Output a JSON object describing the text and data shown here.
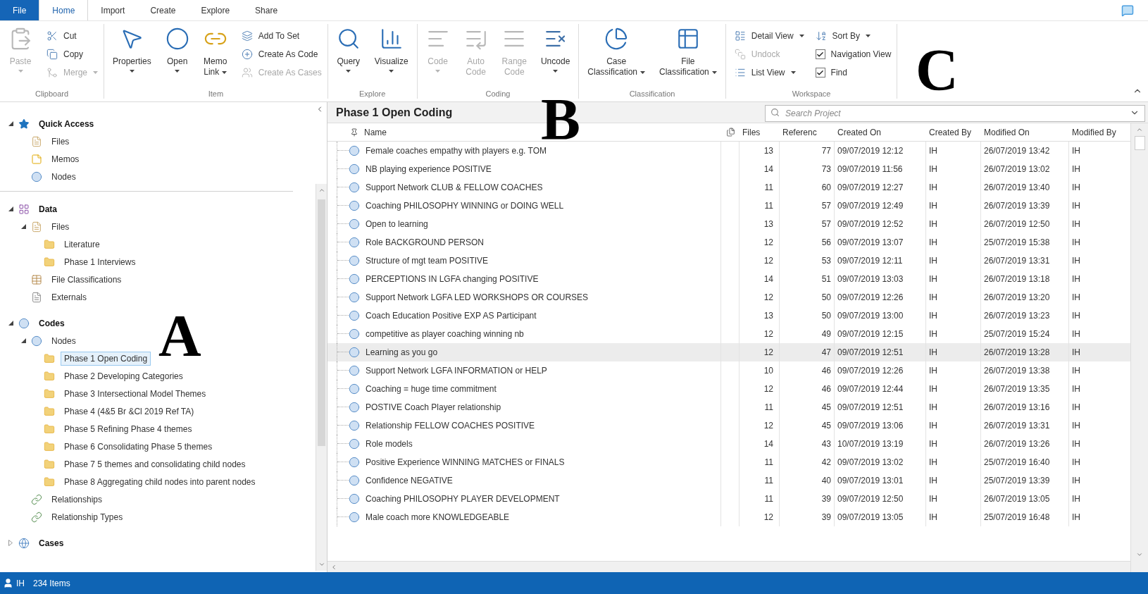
{
  "tabs": [
    {
      "label": "File",
      "kind": "file",
      "selected": false
    },
    {
      "label": "Home",
      "kind": "tab",
      "selected": true
    },
    {
      "label": "Import",
      "kind": "tab",
      "selected": false
    },
    {
      "label": "Create",
      "kind": "tab",
      "selected": false
    },
    {
      "label": "Explore",
      "kind": "tab",
      "selected": false
    },
    {
      "label": "Share",
      "kind": "tab",
      "selected": false
    }
  ],
  "ribbon": {
    "groups": [
      {
        "label": "Clipboard",
        "large": [
          {
            "lines": [
              "Paste"
            ],
            "dropdown": true,
            "disabled": true
          }
        ],
        "small_columns": [
          [
            {
              "kind": "button",
              "label": "Cut",
              "dropdown": false,
              "disabled": false
            },
            {
              "kind": "button",
              "label": "Copy",
              "dropdown": false,
              "disabled": false
            },
            {
              "kind": "button",
              "label": "Merge",
              "dropdown": true,
              "disabled": true
            }
          ]
        ]
      },
      {
        "label": "Item",
        "large": [
          {
            "lines": [
              "Properties"
            ],
            "dropdown": true,
            "disabled": false
          },
          {
            "lines": [
              "Open"
            ],
            "dropdown": true,
            "disabled": false
          },
          {
            "lines": [
              "Memo",
              "Link"
            ],
            "dropdown": true,
            "disabled": false
          }
        ],
        "small_columns": [
          [
            {
              "kind": "button",
              "label": "Add To Set",
              "dropdown": false,
              "disabled": false
            },
            {
              "kind": "button",
              "label": "Create As Code",
              "dropdown": false,
              "disabled": false
            },
            {
              "kind": "button",
              "label": "Create As Cases",
              "dropdown": false,
              "disabled": true
            }
          ]
        ]
      },
      {
        "label": "Explore",
        "large": [
          {
            "lines": [
              "Query"
            ],
            "dropdown": true,
            "disabled": false
          },
          {
            "lines": [
              "Visualize"
            ],
            "dropdown": true,
            "disabled": false
          }
        ]
      },
      {
        "label": "Coding",
        "large": [
          {
            "lines": [
              "Code"
            ],
            "dropdown": true,
            "disabled": true
          },
          {
            "lines": [
              "Auto",
              "Code"
            ],
            "dropdown": false,
            "disabled": true
          },
          {
            "lines": [
              "Range",
              "Code"
            ],
            "dropdown": false,
            "disabled": true
          },
          {
            "lines": [
              "Uncode"
            ],
            "dropdown": true,
            "disabled": false
          }
        ]
      },
      {
        "label": "Classification",
        "large": [
          {
            "lines": [
              "Case",
              "Classification"
            ],
            "dropdown": true,
            "disabled": false
          },
          {
            "lines": [
              "File",
              "Classification"
            ],
            "dropdown": true,
            "disabled": false
          }
        ]
      },
      {
        "label": "Workspace",
        "small_columns": [
          [
            {
              "kind": "button",
              "label": "Detail View",
              "dropdown": true,
              "disabled": false
            },
            {
              "kind": "button",
              "label": "Undock",
              "dropdown": false,
              "disabled": true
            },
            {
              "kind": "button",
              "label": "List View",
              "dropdown": true,
              "disabled": false
            }
          ],
          [
            {
              "kind": "button",
              "label": "Sort By",
              "dropdown": true,
              "disabled": false
            },
            {
              "kind": "checkbox",
              "label": "Navigation View",
              "checked": true
            },
            {
              "kind": "checkbox",
              "label": "Find",
              "checked": true
            }
          ]
        ]
      }
    ]
  },
  "navigation": [
    {
      "label": "Quick Access",
      "kind": "star",
      "expanded": true,
      "children": [
        {
          "label": "Files",
          "kind": "files",
          "selected": false
        },
        {
          "label": "Memos",
          "kind": "memos",
          "selected": false
        },
        {
          "label": "Nodes",
          "kind": "nodes",
          "selected": false
        }
      ]
    },
    {
      "label": "Data",
      "kind": "data",
      "expanded": true,
      "children": [
        {
          "label": "Files",
          "kind": "files",
          "expanded": true,
          "selected": false,
          "children": [
            {
              "label": "Literature",
              "kind": "folder",
              "selected": false
            },
            {
              "label": "Phase 1 Interviews",
              "kind": "folder",
              "selected": false
            }
          ]
        },
        {
          "label": "File Classifications",
          "kind": "classifications",
          "selected": false
        },
        {
          "label": "Externals",
          "kind": "externals",
          "selected": false
        }
      ]
    },
    {
      "label": "Codes",
      "kind": "codes",
      "expanded": true,
      "children": [
        {
          "label": "Nodes",
          "kind": "nodes",
          "expanded": true,
          "selected": false,
          "children": [
            {
              "label": "Phase 1 Open Coding",
              "kind": "folder",
              "selected": true
            },
            {
              "label": "Phase 2 Developing Categories",
              "kind": "folder",
              "selected": false
            },
            {
              "label": "Phase 3 Intersectional Model Themes",
              "kind": "folder",
              "selected": false
            },
            {
              "label": "Phase 4 (4&5 Br &Cl 2019 Ref TA)",
              "kind": "folder",
              "selected": false
            },
            {
              "label": "Phase 5 Refining Phase 4 themes",
              "kind": "folder",
              "selected": false
            },
            {
              "label": "Phase 6 Consolidating Phase 5 themes",
              "kind": "folder",
              "selected": false
            },
            {
              "label": "Phase 7 5 themes and consolidating child nodes",
              "kind": "folder",
              "selected": false
            },
            {
              "label": "Phase 8 Aggregating child nodes into parent nodes",
              "kind": "folder",
              "selected": false
            }
          ]
        },
        {
          "label": "Relationships",
          "kind": "relationships",
          "selected": false
        },
        {
          "label": "Relationship Types",
          "kind": "relationships",
          "selected": false
        }
      ]
    },
    {
      "label": "Cases",
      "kind": "cases",
      "expanded": false
    }
  ],
  "view": {
    "title": "Phase 1 Open Coding",
    "search": {
      "placeholder": "Search Project"
    },
    "columns": [
      "Name",
      "Files",
      "Referenc",
      "Created On",
      "Created By",
      "Modified On",
      "Modified By"
    ],
    "rows": [
      {
        "selected": false,
        "cells": [
          "Female coaches empathy with players e.g. TOM",
          "13",
          "77",
          "09/07/2019 12:12",
          "IH",
          "26/07/2019 13:42",
          "IH"
        ]
      },
      {
        "selected": false,
        "cells": [
          "NB playing experience POSITIVE",
          "14",
          "73",
          "09/07/2019 11:56",
          "IH",
          "26/07/2019 13:02",
          "IH"
        ]
      },
      {
        "selected": false,
        "cells": [
          "Support Network CLUB & FELLOW COACHES",
          "11",
          "60",
          "09/07/2019 12:27",
          "IH",
          "26/07/2019 13:40",
          "IH"
        ]
      },
      {
        "selected": false,
        "cells": [
          "Coaching PHILOSOPHY WINNING or DOING WELL",
          "11",
          "57",
          "09/07/2019 12:49",
          "IH",
          "26/07/2019 13:39",
          "IH"
        ]
      },
      {
        "selected": false,
        "cells": [
          "Open to learning",
          "13",
          "57",
          "09/07/2019 12:52",
          "IH",
          "26/07/2019 12:50",
          "IH"
        ]
      },
      {
        "selected": false,
        "cells": [
          "Role BACKGROUND PERSON",
          "12",
          "56",
          "09/07/2019 13:07",
          "IH",
          "25/07/2019 15:38",
          "IH"
        ]
      },
      {
        "selected": false,
        "cells": [
          "Structure of mgt team POSITIVE",
          "12",
          "53",
          "09/07/2019 12:11",
          "IH",
          "26/07/2019 13:31",
          "IH"
        ]
      },
      {
        "selected": false,
        "cells": [
          "PERCEPTIONS IN LGFA changing POSITIVE",
          "14",
          "51",
          "09/07/2019 13:03",
          "IH",
          "26/07/2019 13:18",
          "IH"
        ]
      },
      {
        "selected": false,
        "cells": [
          "Support Network LGFA LED WORKSHOPS OR COURSES",
          "12",
          "50",
          "09/07/2019 12:26",
          "IH",
          "26/07/2019 13:20",
          "IH"
        ]
      },
      {
        "selected": false,
        "cells": [
          "Coach Education Positive EXP AS Participant",
          "13",
          "50",
          "09/07/2019 13:00",
          "IH",
          "26/07/2019 13:23",
          "IH"
        ]
      },
      {
        "selected": false,
        "cells": [
          "competitive as player  coaching winning nb",
          "12",
          "49",
          "09/07/2019 12:15",
          "IH",
          "25/07/2019 15:24",
          "IH"
        ]
      },
      {
        "selected": true,
        "cells": [
          "Learning as you go",
          "12",
          "47",
          "09/07/2019 12:51",
          "IH",
          "26/07/2019 13:28",
          "IH"
        ]
      },
      {
        "selected": false,
        "cells": [
          "Support Network LGFA INFORMATION or HELP",
          "10",
          "46",
          "09/07/2019 12:26",
          "IH",
          "26/07/2019 13:38",
          "IH"
        ]
      },
      {
        "selected": false,
        "cells": [
          "Coaching = huge time commitment",
          "12",
          "46",
          "09/07/2019 12:44",
          "IH",
          "26/07/2019 13:35",
          "IH"
        ]
      },
      {
        "selected": false,
        "cells": [
          "POSTIVE Coach Player relationship",
          "11",
          "45",
          "09/07/2019 12:51",
          "IH",
          "26/07/2019 13:16",
          "IH"
        ]
      },
      {
        "selected": false,
        "cells": [
          "Relationship FELLOW COACHES POSITIVE",
          "12",
          "45",
          "09/07/2019 13:06",
          "IH",
          "26/07/2019 13:31",
          "IH"
        ]
      },
      {
        "selected": false,
        "cells": [
          "Role models",
          "14",
          "43",
          "10/07/2019 13:19",
          "IH",
          "26/07/2019 13:26",
          "IH"
        ]
      },
      {
        "selected": false,
        "cells": [
          "Positive Experience WINNING MATCHES or FINALS",
          "11",
          "42",
          "09/07/2019 13:02",
          "IH",
          "25/07/2019 16:40",
          "IH"
        ]
      },
      {
        "selected": false,
        "cells": [
          "Confidence NEGATIVE",
          "11",
          "40",
          "09/07/2019 13:01",
          "IH",
          "25/07/2019 13:39",
          "IH"
        ]
      },
      {
        "selected": false,
        "cells": [
          "Coaching PHILOSOPHY PLAYER DEVELOPMENT",
          "11",
          "39",
          "09/07/2019 12:50",
          "IH",
          "26/07/2019 13:05",
          "IH"
        ]
      },
      {
        "selected": false,
        "cells": [
          "Male coach more KNOWLEDGEABLE",
          "12",
          "39",
          "09/07/2019 13:05",
          "IH",
          "25/07/2019 16:48",
          "IH"
        ]
      }
    ]
  },
  "status_bar": {
    "user": "IH",
    "count": "234 Items"
  },
  "annotations": [
    "A",
    "B",
    "C"
  ]
}
